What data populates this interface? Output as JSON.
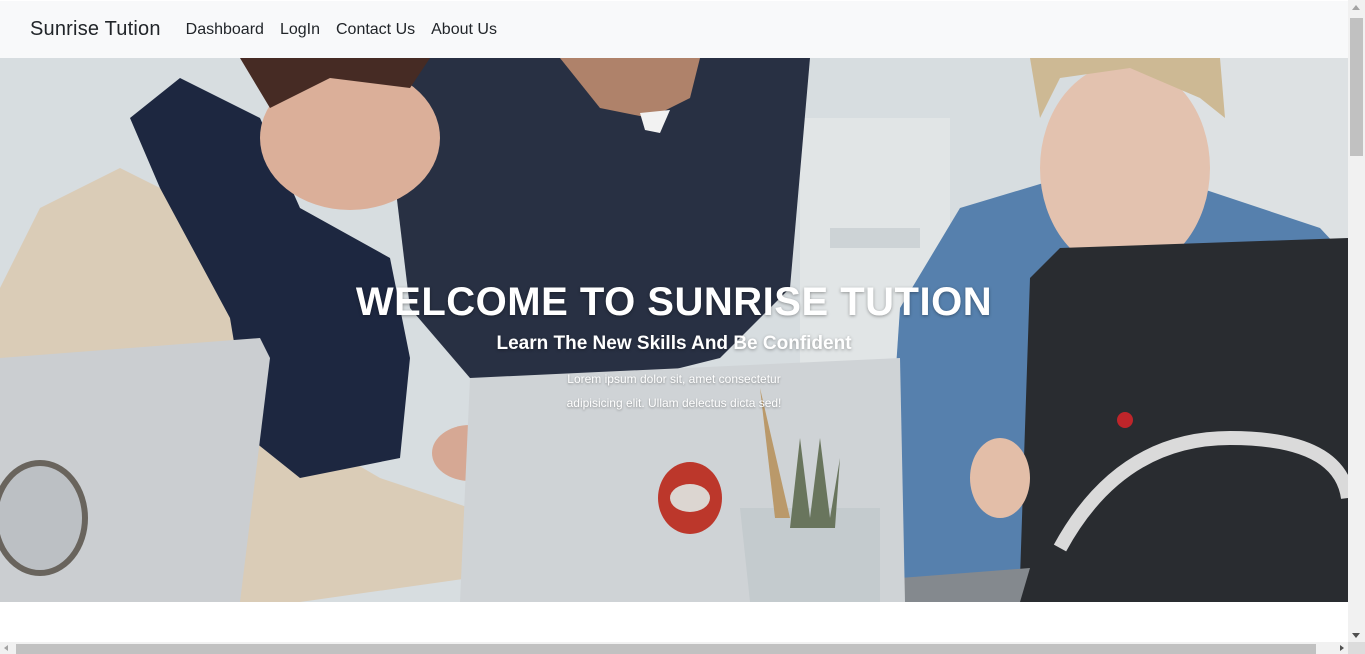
{
  "navbar": {
    "brand": "Sunrise Tution",
    "items": [
      {
        "label": "Dashboard"
      },
      {
        "label": "LogIn"
      },
      {
        "label": "Contact Us"
      },
      {
        "label": "About Us"
      }
    ]
  },
  "hero": {
    "title": "WELCOME TO SUNRISE TUTION",
    "subtitle": "Learn The New Skills And Be Confident",
    "description": "Lorem ipsum dolor sit, amet consectetur adipisicing elit. Ullam delectus dicta sed!"
  },
  "colors": {
    "navbar_bg": "#f8f9fa",
    "text_dark": "#212529",
    "caption_text": "#ffffff"
  }
}
